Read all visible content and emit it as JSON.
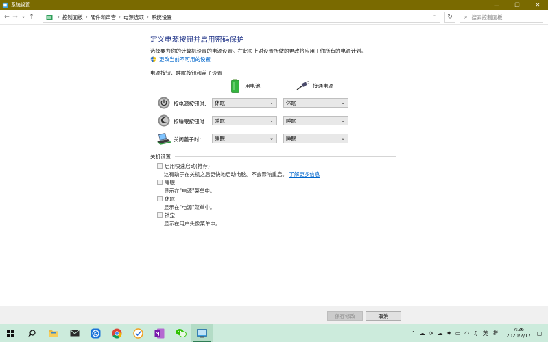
{
  "window": {
    "title": "系统设置",
    "minimize": "—",
    "maximize": "❐",
    "close": "✕"
  },
  "addressbar": {
    "crumbs": [
      "控制面板",
      "硬件和声音",
      "电源选项",
      "系统设置"
    ],
    "search_placeholder": "搜索控制面板"
  },
  "content": {
    "heading": "定义电源按钮并启用密码保护",
    "description": "选择要为你的计算机设置的电源设置。在此页上对设置所做的更改将应用于你所有的电源计划。",
    "change_link": "更改当前不可用的设置",
    "power_section_title": "电源按钮、睡眠按钮和盖子设置",
    "col_battery": "用电池",
    "col_plugged": "接通电源",
    "rows": [
      {
        "label": "按电源按钮时:",
        "battery": "休眠",
        "plugged": "休眠",
        "icon": "power-button-icon"
      },
      {
        "label": "按睡眠按钮时:",
        "battery": "睡眠",
        "plugged": "睡眠",
        "icon": "sleep-button-icon"
      },
      {
        "label": "关闭盖子时:",
        "battery": "睡眠",
        "plugged": "睡眠",
        "icon": "laptop-lid-icon"
      }
    ],
    "shutdown_section_title": "关机设置",
    "options": [
      {
        "label": "启用快速启动(推荐)",
        "desc": "这有助于在关机之后更快地启动电脑。不会影响重启。",
        "link": "了解更多信息"
      },
      {
        "label": "睡眠",
        "desc": "显示在\"电源\"菜单中。"
      },
      {
        "label": "休眠",
        "desc": "显示在\"电源\"菜单中。"
      },
      {
        "label": "锁定",
        "desc": "显示在用户头像菜单中。"
      }
    ]
  },
  "buttons": {
    "save": "保存修改",
    "cancel": "取消"
  },
  "taskbar": {
    "ime_lang": "英",
    "ime_mode": "拼",
    "time": "7:26",
    "date": "2020/2/17"
  },
  "colors": {
    "titlebar": "#7a6a00",
    "heading": "#1e3287",
    "link": "#0066cc",
    "taskbar": "#ccebdc"
  }
}
